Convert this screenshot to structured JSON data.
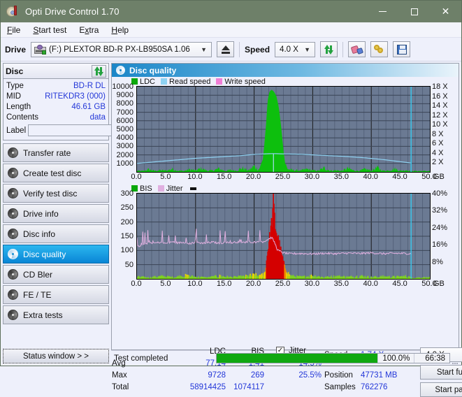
{
  "window": {
    "title": "Opti Drive Control 1.70",
    "app_icon": "disc-icon",
    "minimize": "–",
    "maximize": "□",
    "close": "✕",
    "titlebar_color": "#6e8069"
  },
  "menu": {
    "items": [
      "File",
      "Start test",
      "Extra",
      "Help"
    ]
  },
  "toolbar": {
    "drive_label": "Drive",
    "drive_value": "(F:)   PLEXTOR BD-R  PX-LB950SA 1.06",
    "eject_title": "eject-button",
    "speed_label": "Speed",
    "speed_value": "4.0 X",
    "refresh_title": "refresh-button",
    "erase_title": "erase-button",
    "keys_title": "keys-button",
    "save_title": "save-button"
  },
  "disc_panel": {
    "header": "Disc",
    "refresh_icon": "refresh-icon",
    "rows": [
      {
        "key": "Type",
        "value": "BD-R DL"
      },
      {
        "key": "MID",
        "value": "RITEKDR3 (000)"
      },
      {
        "key": "Length",
        "value": "46.61 GB"
      },
      {
        "key": "Contents",
        "value": "data"
      }
    ],
    "label_key": "Label",
    "label_value": "",
    "label_placeholder": ""
  },
  "sidebar": {
    "items": [
      {
        "label": "Transfer rate",
        "active": false
      },
      {
        "label": "Create test disc",
        "active": false
      },
      {
        "label": "Verify test disc",
        "active": false
      },
      {
        "label": "Drive info",
        "active": false
      },
      {
        "label": "Disc info",
        "active": false
      },
      {
        "label": "Disc quality",
        "active": true
      },
      {
        "label": "CD Bler",
        "active": false
      },
      {
        "label": "FE / TE",
        "active": false
      },
      {
        "label": "Extra tests",
        "active": false
      }
    ],
    "status_window_button": "Status window > >"
  },
  "main": {
    "panel_title": "Disc quality",
    "panel_icon": "disc-quality-icon"
  },
  "stats": {
    "col_ldc": "LDC",
    "col_bis": "BIS",
    "jitter_label": "Jitter",
    "jitter_checked": true,
    "row_avg": "Avg",
    "row_max": "Max",
    "row_total": "Total",
    "avg_ldc": "77.14",
    "avg_bis": "1.41",
    "avg_jitter": "14.5%",
    "max_ldc": "9728",
    "max_bis": "269",
    "max_jitter": "25.5%",
    "total_ldc": "58914425",
    "total_bis": "1074117",
    "speed_label": "Speed",
    "speed_value": "1.74 X",
    "position_label": "Position",
    "position_value": "47731 MB",
    "samples_label": "Samples",
    "samples_value": "762276",
    "speed_select": "4.0 X",
    "start_full": "Start full",
    "start_part": "Start part"
  },
  "statusbar": {
    "text": "Test completed",
    "progress_percent": "100.0%",
    "progress_value": 100,
    "elapsed": "66:38"
  },
  "chart_data": [
    {
      "id": "ldc-chart",
      "type": "area",
      "title": "",
      "xlabel": "GB",
      "ylabel": "",
      "xlim": [
        0,
        50
      ],
      "ylim": [
        0,
        10000
      ],
      "y2lim": [
        0,
        20
      ],
      "grid": true,
      "legend_position": "top-left",
      "legend": [
        {
          "name": "LDC",
          "color": "#0ba80b"
        },
        {
          "name": "Read speed",
          "color": "#8fd2f2"
        },
        {
          "name": "Write speed",
          "color": "#f07fd6"
        }
      ],
      "xticks": [
        "0.0",
        "5.0",
        "10.0",
        "15.0",
        "20.0",
        "25.0",
        "30.0",
        "35.0",
        "40.0",
        "45.0",
        "50.0"
      ],
      "yticks": [
        "10000",
        "9000",
        "8000",
        "7000",
        "6000",
        "5000",
        "4000",
        "3000",
        "2000",
        "1000"
      ],
      "y2ticks": [
        "18 X",
        "16 X",
        "14 X",
        "12 X",
        "10 X",
        "8 X",
        "6 X",
        "4 X",
        "2 X"
      ],
      "series": [
        {
          "name": "LDC",
          "color": "#0ba80b",
          "type": "area",
          "note": "baseline noise ~50-400 across disc; large spike centered 22.2-25.5 GB peaking ~9700",
          "x": [
            0,
            1,
            2,
            3,
            4,
            5,
            6,
            7,
            8,
            9,
            10,
            11,
            12,
            13,
            14,
            15,
            16,
            17,
            18,
            19,
            20,
            20.8,
            21.5,
            22,
            22.3,
            22.6,
            23,
            23.4,
            23.8,
            24.2,
            24.6,
            25,
            25.3,
            25.6,
            26,
            26.5,
            27,
            28,
            29,
            30,
            31,
            32,
            33,
            34,
            35,
            36,
            37,
            38,
            39,
            40,
            41,
            42,
            43,
            44,
            45,
            46,
            46.8
          ],
          "values": [
            120,
            90,
            260,
            110,
            180,
            140,
            320,
            130,
            100,
            260,
            150,
            380,
            120,
            160,
            340,
            110,
            200,
            130,
            420,
            150,
            600,
            250,
            1500,
            5200,
            8300,
            9400,
            9650,
            9400,
            8900,
            7600,
            5400,
            2600,
            900,
            400,
            260,
            200,
            180,
            150,
            300,
            160,
            130,
            420,
            140,
            170,
            120,
            380,
            150,
            110,
            300,
            130,
            450,
            120,
            160,
            340,
            120,
            200,
            90
          ]
        },
        {
          "name": "Read speed",
          "color": "#8fd2f2",
          "type": "line",
          "axis": "y2",
          "note": "rises from ~2.0X at 0GB to ~4.3X near 23GB, dips briefly, then declines to ~2.1X at 46.8GB",
          "x": [
            0,
            2.5,
            5,
            7.5,
            10,
            12.5,
            15,
            17.5,
            20,
            22,
            23.3,
            24.5,
            26,
            28,
            30,
            33,
            36,
            39,
            42,
            45,
            46.8
          ],
          "values": [
            2.0,
            2.3,
            2.6,
            2.9,
            3.2,
            3.4,
            3.6,
            3.8,
            4.1,
            4.25,
            4.3,
            4.25,
            4.2,
            4.15,
            4.0,
            3.8,
            3.6,
            3.3,
            2.9,
            2.4,
            2.1
          ]
        },
        {
          "name": "Write speed",
          "color": "#f07fd6",
          "type": "line",
          "x": [],
          "values": []
        }
      ],
      "markers": [
        {
          "name": "position-cursor",
          "x": 46.8,
          "color": "#39c8ee"
        },
        {
          "name": "peak-drop-line",
          "x": 23.3,
          "color": "#8fd2f2"
        }
      ]
    },
    {
      "id": "bis-jitter-chart",
      "type": "area",
      "title": "",
      "xlabel": "GB",
      "ylabel": "",
      "xlim": [
        0,
        50
      ],
      "ylim": [
        0,
        300
      ],
      "y2lim": [
        0,
        40
      ],
      "grid": true,
      "legend_position": "top-left",
      "legend": [
        {
          "name": "BIS",
          "color": "#0ba80b"
        },
        {
          "name": "Jitter",
          "color": "#e0b0e0"
        }
      ],
      "xticks": [
        "0.0",
        "5.0",
        "10.0",
        "15.0",
        "20.0",
        "25.0",
        "30.0",
        "35.0",
        "40.0",
        "45.0",
        "50.0"
      ],
      "yticks": [
        "300",
        "250",
        "200",
        "150",
        "100",
        "50"
      ],
      "y2ticks": [
        "40%",
        "32%",
        "24%",
        "16%",
        "8%"
      ],
      "series": [
        {
          "name": "BIS",
          "color": "#7ed321",
          "type": "area",
          "note": "low green baseline ~2-12 across disc; red/orange spike 21.8-25.8 GB peaking ~269 at 23.2 GB",
          "x": [
            0,
            2,
            4,
            6,
            8,
            10,
            12,
            14,
            16,
            18,
            20,
            21,
            21.8,
            22.2,
            22.6,
            23,
            23.2,
            23.5,
            23.9,
            24.3,
            24.7,
            25.1,
            25.5,
            25.9,
            26.5,
            28,
            30,
            32,
            34,
            36,
            38,
            40,
            42,
            44,
            46,
            46.8
          ],
          "values": [
            6,
            4,
            8,
            5,
            10,
            6,
            4,
            9,
            5,
            7,
            12,
            8,
            25,
            95,
            150,
            210,
            269,
            185,
            150,
            115,
            80,
            45,
            22,
            12,
            8,
            6,
            10,
            5,
            8,
            6,
            9,
            5,
            7,
            6,
            8,
            4
          ]
        },
        {
          "name": "Jitter",
          "color": "#e0b0e0",
          "type": "line",
          "axis": "y2",
          "note": "~16-17% (125-135 units) noisy with spikes to ~25% before 21.5GB; drops to ~12% (90 units) after 25.5 GB",
          "x": [
            0,
            1,
            2,
            3,
            4,
            5,
            6,
            7,
            8,
            9,
            10,
            11,
            12,
            13,
            14,
            15,
            16,
            17,
            18,
            19,
            20,
            21,
            21.5,
            22,
            23,
            23.5,
            24,
            25,
            26,
            28,
            30,
            32,
            34,
            36,
            38,
            40,
            42,
            44,
            46,
            46.8
          ],
          "values": [
            15.0,
            16.2,
            17.0,
            16.8,
            17.2,
            16.6,
            17.4,
            16.9,
            17.1,
            16.5,
            17.3,
            16.8,
            17.0,
            17.2,
            16.7,
            17.1,
            16.9,
            17.3,
            17.0,
            17.5,
            17.2,
            17.6,
            17.4,
            18.0,
            19.5,
            17.0,
            13.5,
            12.2,
            11.8,
            11.9,
            11.7,
            12.0,
            11.8,
            12.1,
            11.9,
            12.2,
            11.8,
            12.0,
            11.9,
            11.8
          ]
        }
      ],
      "markers": [
        {
          "name": "position-cursor",
          "x": 46.8,
          "color": "#39c8ee"
        }
      ]
    }
  ]
}
